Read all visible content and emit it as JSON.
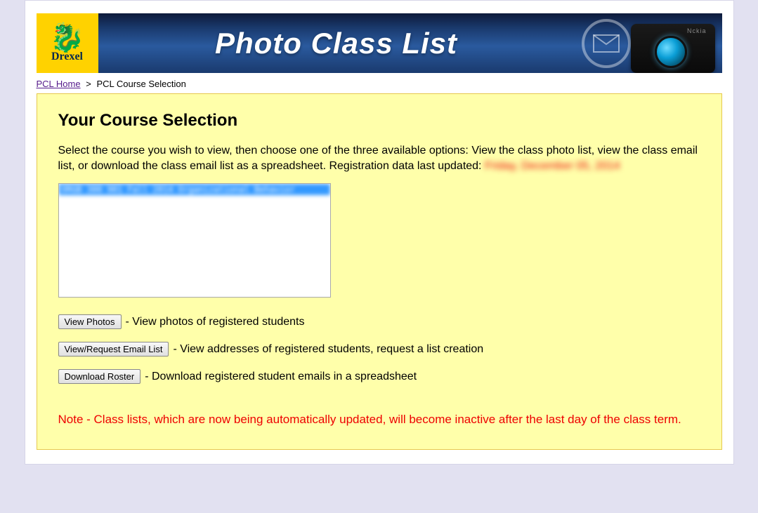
{
  "banner": {
    "logo_text": "Drexel",
    "title": "Photo Class List",
    "camera_brand": "Nckia"
  },
  "breadcrumb": {
    "home_label": "PCL Home",
    "separator": ">",
    "current": "PCL Course Selection"
  },
  "panel": {
    "heading": "Your Course Selection",
    "intro_prefix": "Select the course you wish to view, then choose one of the three available options: View the class photo list, view the class email list, or download the class email list as a spreadsheet.  Registration data last updated: ",
    "updated_date": "Friday, December 05, 2014",
    "course_options": [
      "ORGB 300 901 Fall 2014 Organizational Behavior"
    ],
    "actions": {
      "view_photos": {
        "button": "View Photos",
        "desc": " - View photos of registered students"
      },
      "view_email": {
        "button": "View/Request Email List",
        "desc": " - View addresses of registered students, request a list creation"
      },
      "download": {
        "button": "Download Roster",
        "desc": " - Download registered student emails in a spreadsheet"
      }
    },
    "note": "Note - Class lists, which are now being automatically updated, will become inactive after the last day of the class term."
  }
}
